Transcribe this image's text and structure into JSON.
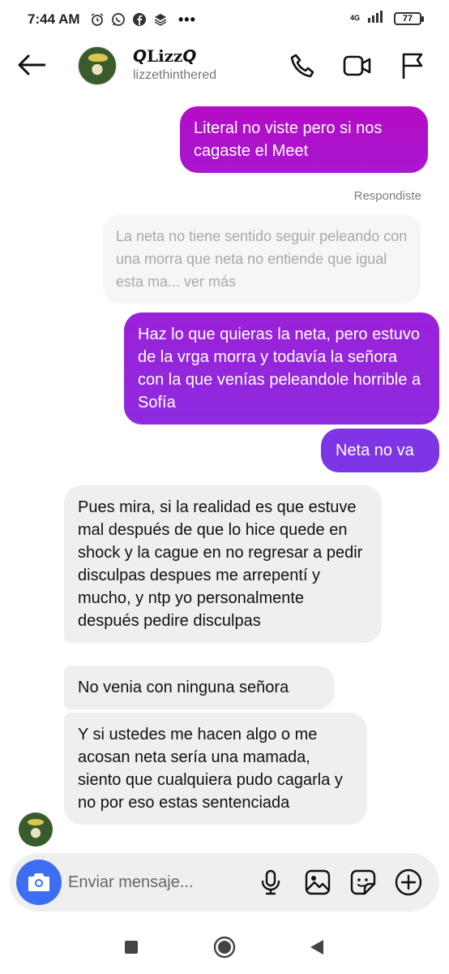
{
  "status_bar": {
    "time": "7:44 AM",
    "left_icons": [
      "alarm-icon",
      "whatsapp-icon",
      "facebook-icon",
      "layers-icon"
    ],
    "more": "•••",
    "network": "4G",
    "battery": "77"
  },
  "header": {
    "contact_name": "𝙌Lizz𝙌",
    "username": "lizzethinthered",
    "icons": [
      "back-arrow-icon",
      "phone-icon",
      "video-camera-icon",
      "flag-icon"
    ]
  },
  "messages": {
    "out_1": "Literal no viste pero si nos cagaste el Meet",
    "replied_label": "Respondiste",
    "reply_quote": "La neta no tiene sentido seguir peleando con una morra que neta no entiende que igual esta ma... ver más",
    "out_2": "Haz lo que quieras la neta, pero estuvo de la vrga morra y todavía la señora con la que venías peleandole horrible a Sofía",
    "out_3": "Neta no va",
    "in_1": "Pues mira, si la realidad es que estuve mal después de que lo hice quede en shock y la cague en no regresar a pedir disculpas despues me arrepentí y mucho, y ntp yo personalmente después pedire disculpas",
    "in_2": "No venia con ninguna señora",
    "in_3": "Y si ustedes me hacen algo o me acosan neta sería una mamada, siento que cualquiera pudo cagarla y no por eso estas sentenciada"
  },
  "composer": {
    "placeholder": "Enviar mensaje...",
    "icons": [
      "camera-icon",
      "microphone-icon",
      "image-icon",
      "sticker-icon",
      "add-icon"
    ]
  },
  "colors": {
    "out_bubble_top": "#b40cc6",
    "out_bubble_mid": "#9a21d9",
    "out_bubble_bottom": "#7e35e6",
    "in_bubble": "#efefef",
    "camera_button": "#3d6ef2"
  },
  "nav_bar": {
    "icons": [
      "recents-square-icon",
      "home-circle-icon",
      "back-triangle-icon"
    ]
  }
}
